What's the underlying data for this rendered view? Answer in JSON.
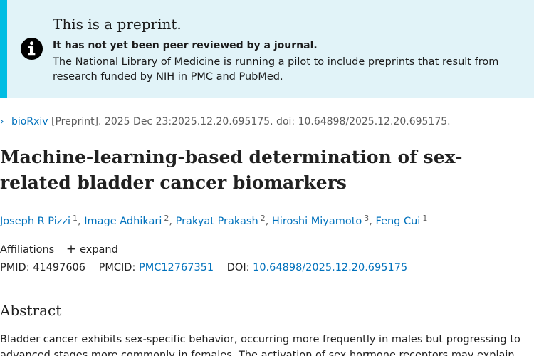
{
  "banner": {
    "title": "This is a preprint.",
    "subtitle": "It has not yet been peer reviewed by a journal.",
    "text_before_link": "The National Library of Medicine is ",
    "link_text": "running a pilot",
    "text_after_link": " to include preprints that result from research funded by NIH in PMC and PubMed.",
    "icon": "info-icon"
  },
  "citation": {
    "journal": "bioRxiv",
    "details": " [Preprint]. 2025 Dec 23:2025.12.20.695175. doi: 10.64898/2025.12.20.695175."
  },
  "article": {
    "title": "Machine-learning-based determination of sex-related bladder cancer biomarkers"
  },
  "authors": [
    {
      "name": "Joseph R Pizzi",
      "affil": "1"
    },
    {
      "name": "Image Adhikari",
      "affil": "2"
    },
    {
      "name": "Prakyat Prakash",
      "affil": "2"
    },
    {
      "name": "Hiroshi Miyamoto",
      "affil": "3"
    },
    {
      "name": "Feng Cui",
      "affil": "1"
    }
  ],
  "affiliations": {
    "label": "Affiliations",
    "expand_label": "expand"
  },
  "ids": {
    "pmid_label": "PMID:",
    "pmid": "41497606",
    "pmcid_label": "PMCID:",
    "pmcid": "PMC12767351",
    "doi_label": "DOI:",
    "doi": "10.64898/2025.12.20.695175"
  },
  "abstract": {
    "heading": "Abstract",
    "text": "Bladder cancer exhibits sex-specific behavior, occurring more frequently in males but progressing to advanced stages more commonly in females. The activation of sex hormone receptors may explain"
  }
}
